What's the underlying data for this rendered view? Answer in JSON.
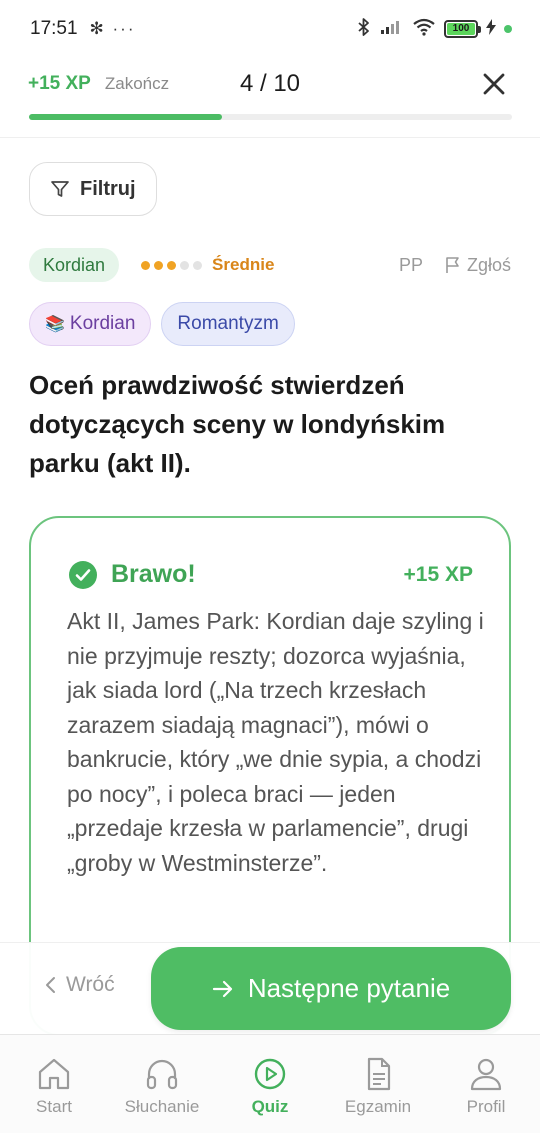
{
  "status_bar": {
    "time": "17:51",
    "left_icons": "✻ ···",
    "battery": "100"
  },
  "header": {
    "xp_earned": "+15 XP",
    "finish_label": "Zakończ",
    "progress_text": "4 / 10",
    "progress_fraction": 0.4
  },
  "filter": {
    "label": "Filtruj"
  },
  "meta": {
    "category": "Kordian",
    "difficulty_label": "Średnie",
    "difficulty_level": 3,
    "difficulty_max": 5,
    "level_code": "PP",
    "report_label": "Zgłoś"
  },
  "tags": [
    {
      "emoji": "📚",
      "label": "Kordian"
    },
    {
      "label": "Romantyzm"
    }
  ],
  "question": "Oceń prawdziwość stwierdzeń dotyczących sceny w londyńskim parku (akt II).",
  "feedback": {
    "title": "Brawo!",
    "xp": "+15 XP",
    "text": "Akt II, James Park: Kordian daje szyling i nie przyjmuje reszty; dozorca wyjaśnia, jak siada lord („Na trzech krzesłach zarazem siadają magnaci”), mówi o bankrucie, który „we dnie sypia, a chodzi po nocy”, i poleca braci — jeden „przedaje krzesła w parlamencie”, drugi „groby w Westminsterze”."
  },
  "actions": {
    "back_label": "Wróć",
    "next_label": "Następne pytanie"
  },
  "nav": [
    {
      "label": "Start",
      "icon": "home-icon"
    },
    {
      "label": "Słuchanie",
      "icon": "headphones-icon"
    },
    {
      "label": "Quiz",
      "icon": "play-circle-icon",
      "active": true
    },
    {
      "label": "Egzamin",
      "icon": "document-icon"
    },
    {
      "label": "Profil",
      "icon": "user-icon"
    }
  ],
  "colors": {
    "accent": "#4fbd64",
    "difficulty": "#f0a324"
  }
}
